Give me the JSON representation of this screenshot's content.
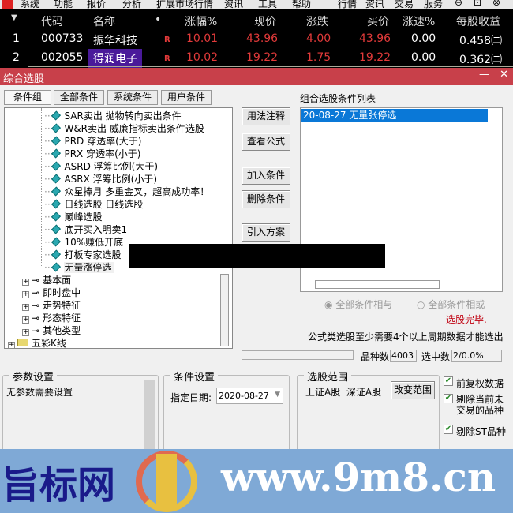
{
  "menubar": {
    "items": [
      "系统",
      "功能",
      "报价",
      "分析",
      "扩展市场行情",
      "资讯",
      "工具",
      "帮助"
    ],
    "right_tabs": [
      "行情",
      "资讯",
      "交易",
      "服务"
    ]
  },
  "quote_table": {
    "headers": [
      "代码",
      "名称",
      "•",
      "涨幅%",
      "现价",
      "涨跌",
      "买价",
      "涨速%",
      "每股收益"
    ],
    "rows": [
      {
        "index": "1",
        "code": "000733",
        "name": "振华科技",
        "flag": "R",
        "change_pct": "10.01",
        "price": "43.96",
        "change": "4.00",
        "bid": "43.96",
        "speed": "0.00",
        "eps": "0.458㈡"
      },
      {
        "index": "2",
        "code": "002055",
        "name": "得润电子",
        "flag": "R",
        "change_pct": "10.02",
        "price": "19.22",
        "change": "1.75",
        "bid": "19.22",
        "speed": "0.00",
        "eps": "0.362㈡"
      }
    ]
  },
  "dialog": {
    "title": "综合选股",
    "tabs": [
      "条件组",
      "全部条件",
      "系统条件",
      "用户条件"
    ],
    "tree_items": [
      "SAR卖出 抛物转向卖出条件",
      "W&R卖出 威廉指标卖出条件选股",
      "PRD 穿透率(大于)",
      "PRX 穿透率(小于)",
      "ASRD 浮筹比例(大于)",
      "ASRX 浮筹比例(小于)",
      "众星捧月 多重金叉，超高成功率！",
      "日线选股 日线选股",
      "巅峰选股",
      "底开买入明卖1",
      "10%赚低开底",
      "打板专家选股",
      "无量涨停选"
    ],
    "tree_groups": [
      "基本面",
      "即时盘中",
      "走势特征",
      "形态特征",
      "其他类型"
    ],
    "tree_root": "五彩K线",
    "buttons": {
      "usage": "用法注释",
      "view_formula": "查看公式",
      "add": "加入条件",
      "delete": "删除条件",
      "import": "引入方案",
      "change_range": "改变范围"
    },
    "list_title": "组合选股条件列表",
    "list_items": [
      "20-08-27 无量张停选"
    ],
    "radio_and": "全部条件相与",
    "radio_or": "全部条件相或",
    "status": "选股完毕.",
    "note": "公式类选股至少需要4个以上周期数据才能选出",
    "count_label": "品种数",
    "count_value": "4003",
    "selected_label": "选中数",
    "selected_value": "2/0.0%",
    "params": {
      "title": "参数设置",
      "text": "无参数需要设置"
    },
    "cond": {
      "title": "条件设置",
      "date_label": "指定日期:",
      "date_value": "2020-08-27"
    },
    "range": {
      "title": "选股范围",
      "text": "上证A股  深证A股"
    },
    "checks": [
      {
        "label": "前复权数据",
        "checked": true
      },
      {
        "label": "剔除当前未交易的品种",
        "checked": true
      },
      {
        "label": "剔除ST品种",
        "checked": true
      }
    ]
  },
  "watermark": {
    "left": "旨标网",
    "right": "www.9m8.cn"
  },
  "colors": {
    "title_bar": "#c8404a",
    "up": "#e23a3a",
    "selection": "#0a78d7",
    "banner": "#7fa9d6"
  }
}
